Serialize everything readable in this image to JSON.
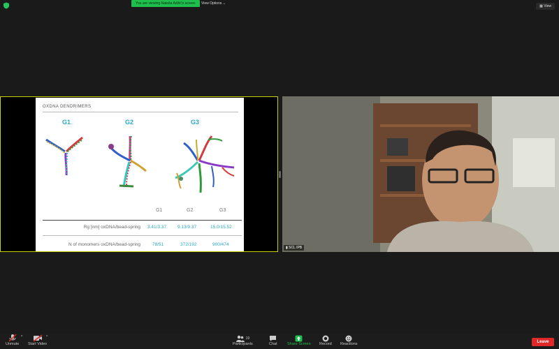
{
  "banner": {
    "text": "You are viewing Nataša Adžić's screen",
    "view_options": "View Options ⌄"
  },
  "view_button": "View",
  "slide": {
    "title": "OXDNA DENDRIMERS",
    "generations": [
      "G1",
      "G2",
      "G3"
    ],
    "table": {
      "col_headers": [
        "G1",
        "G2",
        "G3"
      ],
      "rows": [
        {
          "label": "Rg [nm] oxDNA/bead-spring",
          "values": [
            "3.41/3.37",
            "9.13/9.37",
            "15.0/15.52"
          ]
        },
        {
          "label": "N of monomers oxDNA/bead-spring",
          "values": [
            "78/51",
            "372/192",
            "900/474"
          ]
        }
      ]
    }
  },
  "camera_label": "SCL IPB",
  "toolbar": {
    "unmute": "Unmute",
    "start_video": "Start Video",
    "participants": "Participants",
    "participant_count": "19",
    "chat": "Chat",
    "share_screen": "Share Screen",
    "record": "Record",
    "reactions": "Reactions",
    "leave": "Leave"
  },
  "colors": {
    "accent": "#2aa9c8",
    "share_green": "#1fbf4d",
    "leave_red": "#e02828",
    "active_border": "#c9d000"
  }
}
